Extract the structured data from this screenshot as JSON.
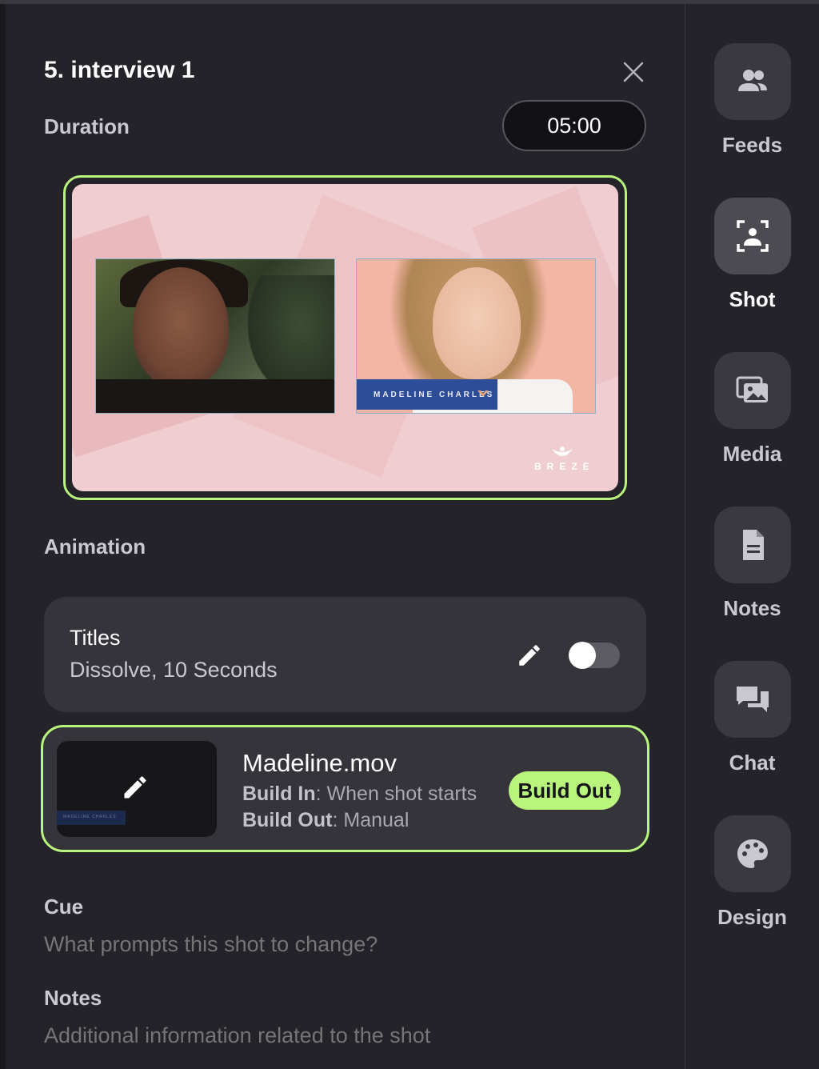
{
  "panel": {
    "title": "5. interview 1",
    "duration_label": "Duration",
    "duration_value": "05:00",
    "animation_label": "Animation",
    "preview": {
      "lower_third_text": "MADELINE CHARLES",
      "brand_text": "BREZE"
    },
    "titles_card": {
      "name": "Titles",
      "description": "Dissolve, 10 Seconds",
      "toggle_on": false
    },
    "media_card": {
      "file_name": "Madeline.mov",
      "build_in_label": "Build In",
      "build_in_value": ": When shot starts",
      "build_out_label": "Build Out",
      "build_out_value": ": Manual",
      "build_out_button": "Build Out",
      "thumb_text": "MADELINE CHARLES"
    },
    "cue_label": "Cue",
    "cue_placeholder": "What prompts this shot to change?",
    "notes_label": "Notes",
    "notes_placeholder": "Additional information related to the shot"
  },
  "sidebar": {
    "items": [
      {
        "label": "Feeds",
        "icon": "people-icon",
        "active": false
      },
      {
        "label": "Shot",
        "icon": "shot-frame-icon",
        "active": true
      },
      {
        "label": "Media",
        "icon": "image-stack-icon",
        "active": false
      },
      {
        "label": "Notes",
        "icon": "document-icon",
        "active": false
      },
      {
        "label": "Chat",
        "icon": "chat-bubbles-icon",
        "active": false
      },
      {
        "label": "Design",
        "icon": "palette-icon",
        "active": false
      }
    ]
  },
  "colors": {
    "accent": "#b9f57d",
    "background": "#242329",
    "card": "#35343b",
    "preview_bg": "#f0cdd0",
    "lower_third": "#2e4d99"
  }
}
